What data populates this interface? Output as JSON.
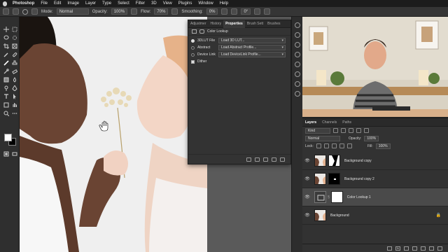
{
  "menubar": {
    "items": [
      "Photoshop",
      "File",
      "Edit",
      "Image",
      "Layer",
      "Type",
      "Select",
      "Filter",
      "3D",
      "View",
      "Plugins",
      "Window",
      "Help"
    ]
  },
  "options": {
    "mode_label": "Mode:",
    "mode_value": "Normal",
    "opacity_label": "Opacity:",
    "opacity_value": "100%",
    "flow_label": "Flow:",
    "flow_value": "70%",
    "smoothing_label": "Smoothing:",
    "smoothing_value": "0%",
    "angle_value": "0°"
  },
  "properties": {
    "tabs": [
      "Adjustmer",
      "History",
      "Properties",
      "Brush Sett",
      "Brushes"
    ],
    "active_tab": "Properties",
    "header": "Color Lookup",
    "rows": [
      {
        "label": "3DLUT File",
        "value": "Load 3D LUT...",
        "selected": true
      },
      {
        "label": "Abstract",
        "value": "Load Abstract Profile...",
        "selected": false
      },
      {
        "label": "Device Link",
        "value": "Load DeviceLink Profile...",
        "selected": false
      }
    ],
    "dither_label": "Dither"
  },
  "layers": {
    "tabs": [
      "Layers",
      "Channels",
      "Paths"
    ],
    "active_tab": "Layers",
    "filter_kind": "Kind",
    "blend_mode": "Normal",
    "opacity_label": "Opacity:",
    "opacity_value": "100%",
    "lock_label": "Lock:",
    "fill_label": "Fill:",
    "fill_value": "100%",
    "list": [
      {
        "name": "Background copy",
        "active": false
      },
      {
        "name": "Background copy 2",
        "active": false
      },
      {
        "name": "Color Lookup 1",
        "active": true
      },
      {
        "name": "Background",
        "active": false
      }
    ],
    "footer_fx": "fx"
  },
  "colors": {
    "app_bg": "#262626",
    "panel_bg": "#333333",
    "active_layer": "#4a4a4a"
  }
}
